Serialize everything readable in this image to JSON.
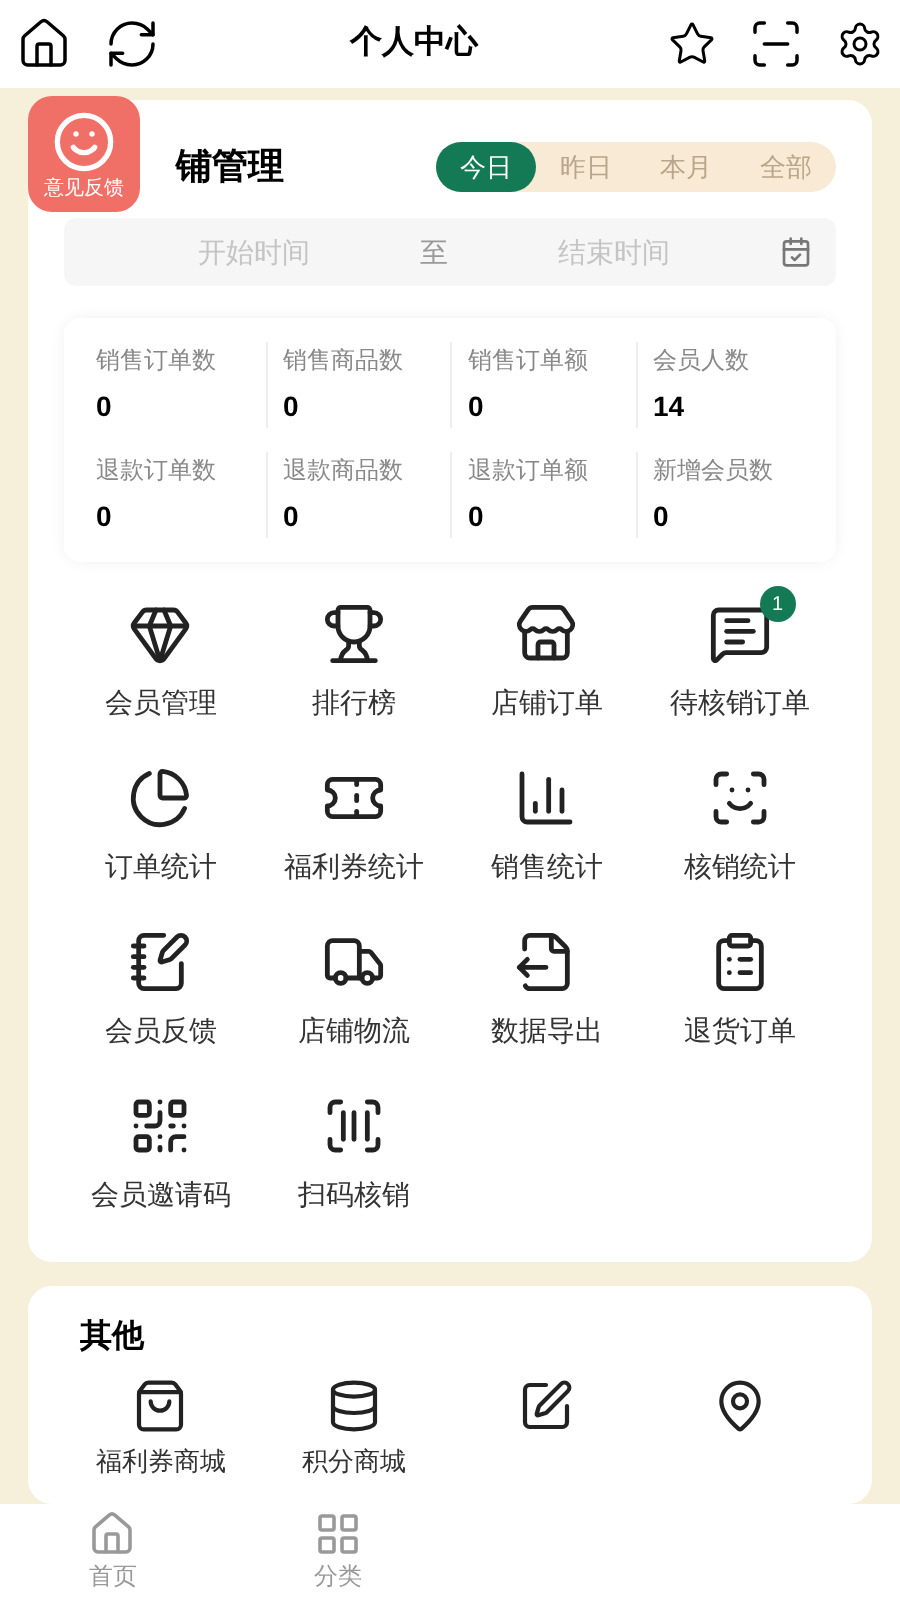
{
  "header": {
    "title": "个人中心"
  },
  "feedback_badge": {
    "label": "意见反馈"
  },
  "store": {
    "title": "铺管理",
    "periods": [
      {
        "label": "今日",
        "selected": true
      },
      {
        "label": "昨日",
        "selected": false
      },
      {
        "label": "本月",
        "selected": false
      },
      {
        "label": "全部",
        "selected": false
      }
    ],
    "date_range": {
      "start_placeholder": "开始时间",
      "separator": "至",
      "end_placeholder": "结束时间"
    },
    "stats": [
      {
        "label": "销售订单数",
        "value": "0"
      },
      {
        "label": "销售商品数",
        "value": "0"
      },
      {
        "label": "销售订单额",
        "value": "0"
      },
      {
        "label": "会员人数",
        "value": "14"
      },
      {
        "label": "退款订单数",
        "value": "0"
      },
      {
        "label": "退款商品数",
        "value": "0"
      },
      {
        "label": "退款订单额",
        "value": "0"
      },
      {
        "label": "新增会员数",
        "value": "0"
      }
    ],
    "menu": [
      {
        "kind": "gem",
        "label": "会员管理"
      },
      {
        "kind": "trophy",
        "label": "排行榜"
      },
      {
        "kind": "store",
        "label": "店铺订单"
      },
      {
        "kind": "message",
        "label": "待核销订单",
        "badge": "1"
      },
      {
        "kind": "pie",
        "label": "订单统计"
      },
      {
        "kind": "ticket",
        "label": "福利券统计"
      },
      {
        "kind": "chart",
        "label": "销售统计"
      },
      {
        "kind": "scanpie",
        "label": "核销统计"
      },
      {
        "kind": "notes",
        "label": "会员反馈"
      },
      {
        "kind": "truck",
        "label": "店铺物流"
      },
      {
        "kind": "export",
        "label": "数据导出"
      },
      {
        "kind": "undo",
        "label": "退货订单"
      },
      {
        "kind": "qr",
        "label": "会员邀请码"
      },
      {
        "kind": "scan",
        "label": "扫码核销"
      }
    ]
  },
  "other": {
    "title": "其他",
    "items": [
      {
        "kind": "bag",
        "label": "福利券商城"
      },
      {
        "kind": "coins",
        "label": "积分商城"
      },
      {
        "kind": "edit"
      },
      {
        "kind": "pin"
      }
    ]
  },
  "tab_bar": [
    {
      "kind": "home",
      "label": "首页",
      "selected": false
    },
    {
      "kind": "grid",
      "label": "分类",
      "selected": false
    }
  ]
}
